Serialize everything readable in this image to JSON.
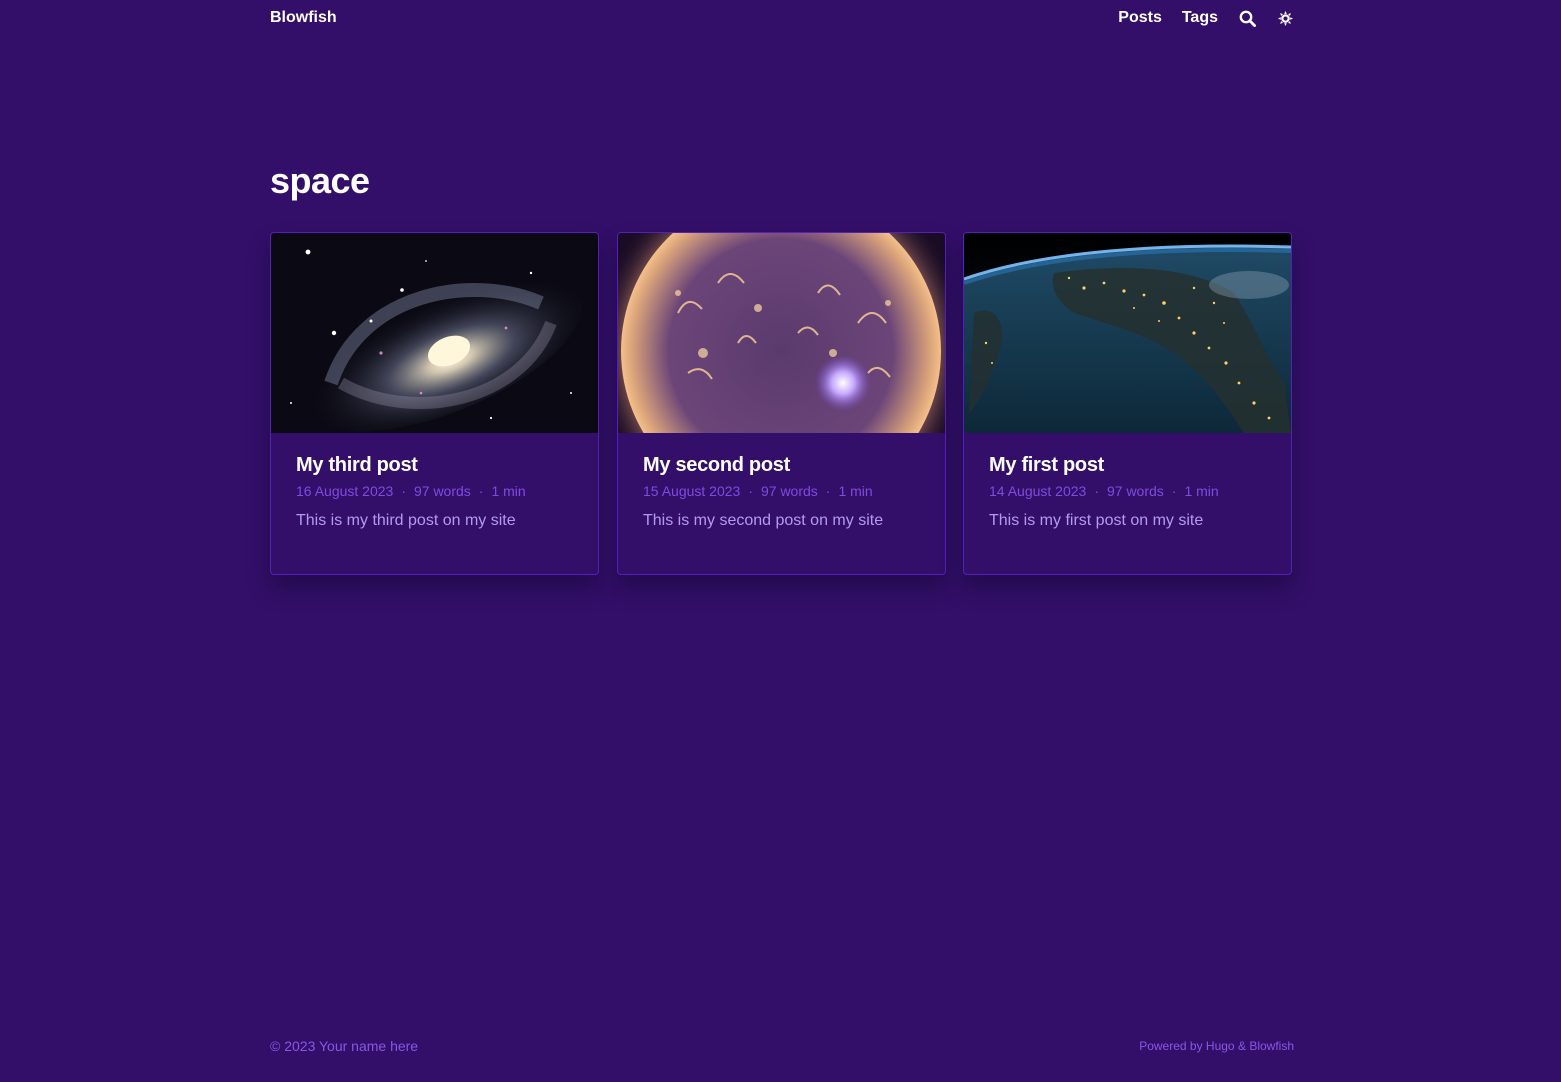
{
  "header": {
    "site_title": "Blowfish",
    "nav": {
      "posts_label": "Posts",
      "tags_label": "Tags"
    },
    "icons": {
      "search": "search-icon",
      "theme": "sun-icon"
    }
  },
  "page": {
    "title": "space"
  },
  "posts": [
    {
      "title": "My third post",
      "date": "16 August 2023",
      "words": "97 words",
      "reading_time": "1 min",
      "summary": "This is my third post on my site",
      "thumbnail": "spiral-galaxy-image"
    },
    {
      "title": "My second post",
      "date": "15 August 2023",
      "words": "97 words",
      "reading_time": "1 min",
      "summary": "This is my second post on my site",
      "thumbnail": "sun-flares-image"
    },
    {
      "title": "My first post",
      "date": "14 August 2023",
      "words": "97 words",
      "reading_time": "1 min",
      "summary": "This is my first post on my site",
      "thumbnail": "earth-at-night-image"
    }
  ],
  "meta_separator": "·",
  "footer": {
    "copyright": "© 2023 Your name here",
    "powered_prefix": "Powered by",
    "hugo_label": "Hugo",
    "amp": "&",
    "blowfish_label": "Blowfish"
  },
  "colors": {
    "background": "#330f69",
    "card_border": "#5420bd",
    "meta_text": "#7f4be0",
    "summary_text": "#b39af0",
    "footer_text": "#8a55e6"
  }
}
